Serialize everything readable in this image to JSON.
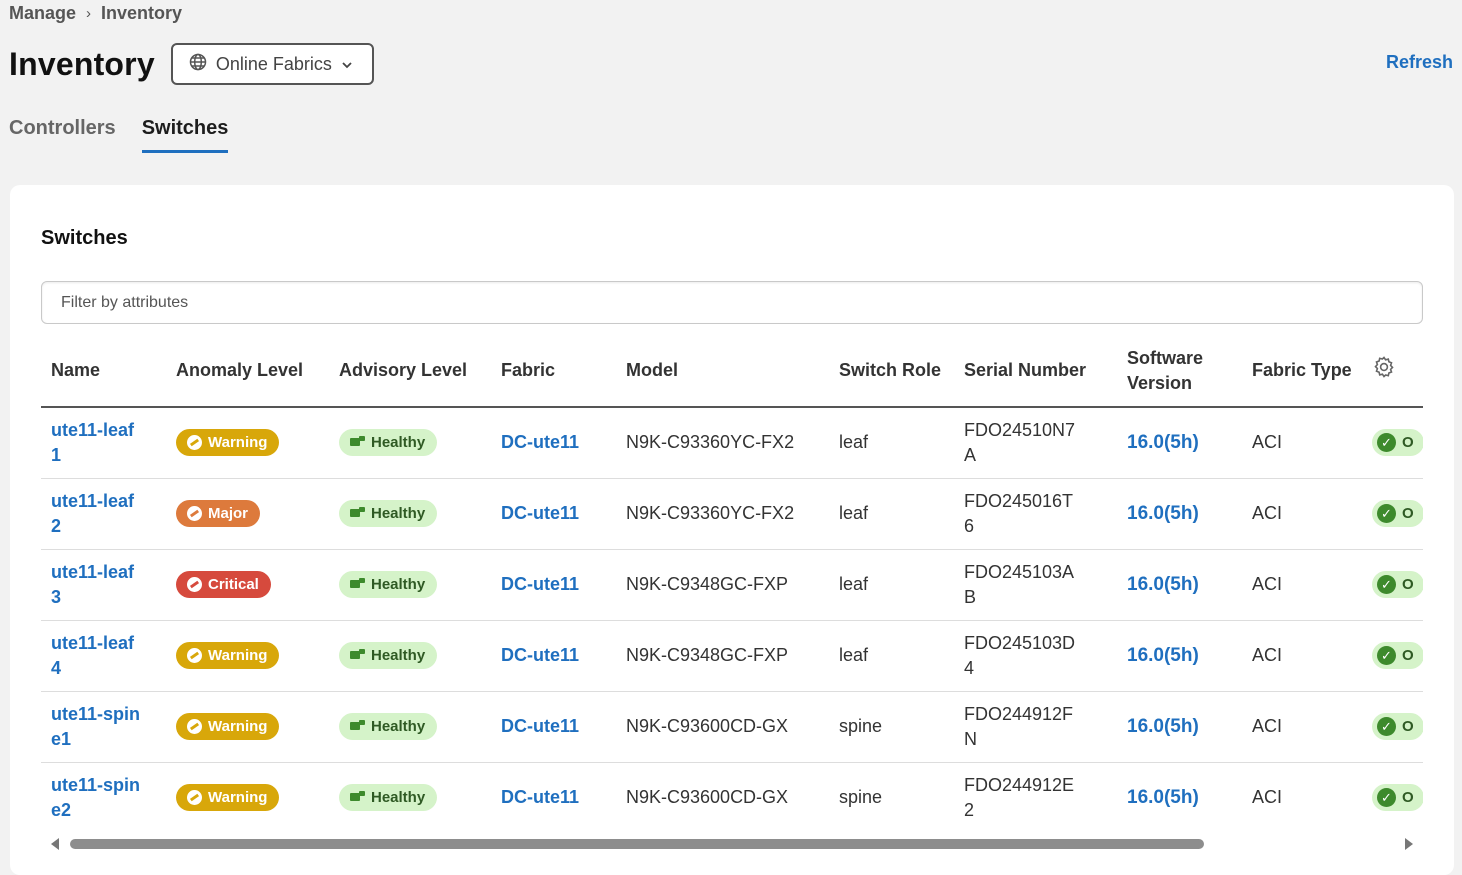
{
  "breadcrumb": {
    "parent": "Manage",
    "separator": "›",
    "current": "Inventory"
  },
  "header": {
    "title": "Inventory",
    "fabric_selector": "Online Fabrics",
    "refresh_label": "Refresh"
  },
  "tabs": [
    {
      "label": "Controllers",
      "active": false
    },
    {
      "label": "Switches",
      "active": true
    }
  ],
  "card": {
    "title": "Switches",
    "filter_placeholder": "Filter by attributes"
  },
  "table": {
    "columns": [
      "Name",
      "Anomaly Level",
      "Advisory Level",
      "Fabric",
      "Model",
      "Switch Role",
      "Serial Number",
      "Software Version",
      "Fabric Type"
    ],
    "rows": [
      {
        "name": "ute11-leaf1",
        "anomaly": "Warning",
        "advisory": "Healthy",
        "fabric": "DC-ute11",
        "model": "N9K-C93360YC-FX2",
        "role": "leaf",
        "serial": "FDO24510N7A",
        "version": "16.0(5h)",
        "fabric_type": "ACI",
        "status": "O"
      },
      {
        "name": "ute11-leaf2",
        "anomaly": "Major",
        "advisory": "Healthy",
        "fabric": "DC-ute11",
        "model": "N9K-C93360YC-FX2",
        "role": "leaf",
        "serial": "FDO245016T6",
        "version": "16.0(5h)",
        "fabric_type": "ACI",
        "status": "O"
      },
      {
        "name": "ute11-leaf3",
        "anomaly": "Critical",
        "advisory": "Healthy",
        "fabric": "DC-ute11",
        "model": "N9K-C9348GC-FXP",
        "role": "leaf",
        "serial": "FDO245103AB",
        "version": "16.0(5h)",
        "fabric_type": "ACI",
        "status": "O"
      },
      {
        "name": "ute11-leaf4",
        "anomaly": "Warning",
        "advisory": "Healthy",
        "fabric": "DC-ute11",
        "model": "N9K-C9348GC-FXP",
        "role": "leaf",
        "serial": "FDO245103D4",
        "version": "16.0(5h)",
        "fabric_type": "ACI",
        "status": "O"
      },
      {
        "name": "ute11-spine1",
        "anomaly": "Warning",
        "advisory": "Healthy",
        "fabric": "DC-ute11",
        "model": "N9K-C93600CD-GX",
        "role": "spine",
        "serial": "FDO244912FN",
        "version": "16.0(5h)",
        "fabric_type": "ACI",
        "status": "O"
      },
      {
        "name": "ute11-spine2",
        "anomaly": "Warning",
        "advisory": "Healthy",
        "fabric": "DC-ute11",
        "model": "N9K-C93600CD-GX",
        "role": "spine",
        "serial": "FDO244912E2",
        "version": "16.0(5h)",
        "fabric_type": "ACI",
        "status": "O"
      }
    ]
  },
  "colors": {
    "accent": "#1f6fbf",
    "warning": "#d8a70a",
    "major": "#dd7a3c",
    "critical": "#d64a3d",
    "healthy_bg": "#d5f3c9"
  }
}
